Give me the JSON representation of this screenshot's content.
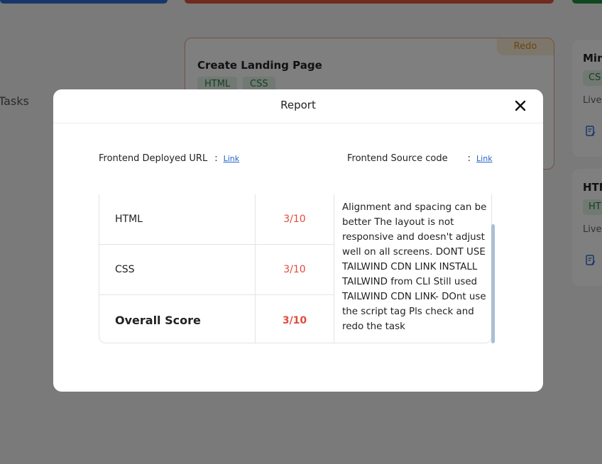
{
  "background": {
    "left_text": "Tasks",
    "main_card": {
      "badge": "Redo",
      "title": "Create Landing Page",
      "tags": [
        "HTML",
        "CSS"
      ]
    },
    "right_cards": [
      {
        "title": "Mini",
        "tag": "CS",
        "live": "Live"
      },
      {
        "title": "HTM",
        "tag": "HT",
        "live": "Live"
      }
    ]
  },
  "modal": {
    "title": "Report",
    "close_icon": "close-icon",
    "links": [
      {
        "label": "Frontend Deployed URL",
        "separator": ":",
        "link_text": "Link"
      },
      {
        "label": "Frontend Source code",
        "separator": ":",
        "link_text": "Link"
      }
    ],
    "table": {
      "rows": [
        {
          "name": "HTML",
          "score": "3/10"
        },
        {
          "name": "CSS",
          "score": "3/10"
        },
        {
          "name": "Overall Score",
          "score": "3/10"
        }
      ],
      "comment": "Alignment and spacing can be better The layout is not responsive and doesn't adjust well on all screens. DONT USE TAILWIND CDN LINK INSTALL TAILWIND from CLI Still used TAILWIND CDN LINK- DOnt use the script tag Pls check and redo the task"
    }
  },
  "colors": {
    "score": "#e24b3b",
    "link": "#2563c9",
    "tag_bg": "#e3f3e6",
    "tag_text": "#2e7d4a",
    "redo_badge": "#d8891e"
  }
}
